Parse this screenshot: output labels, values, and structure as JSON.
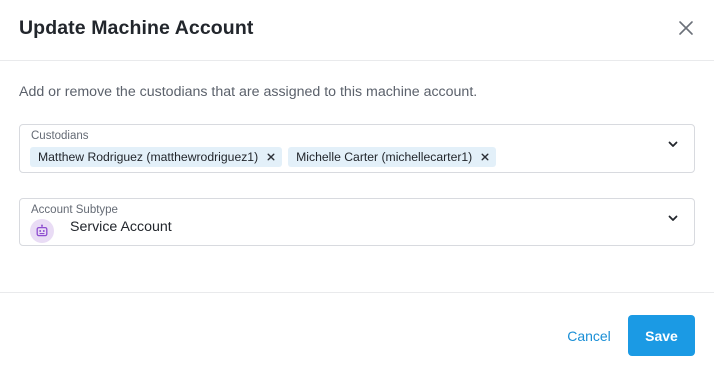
{
  "dialog": {
    "title": "Update Machine Account",
    "close_icon": "close-icon",
    "description": "Add or remove the custodians that are assigned to this machine account."
  },
  "custodians": {
    "label": "Custodians",
    "chevron_icon": "chevron-down-icon",
    "remove_icon": "close-icon",
    "selected": [
      "Matthew Rodriguez (matthewrodriguez1)",
      "Michelle Carter (michellecarter1)"
    ]
  },
  "account_subtype": {
    "label": "Account Subtype",
    "value": "Service Account",
    "value_icon": "robot-icon",
    "chevron_icon": "chevron-down-icon"
  },
  "footer": {
    "cancel_label": "Cancel",
    "save_label": "Save"
  },
  "colors": {
    "primary": "#1b9ae4",
    "chip_background": "#e3f0f9",
    "icon_badge_background": "#e9dcf5",
    "icon_color": "#8e4dd0",
    "border": "#d8dadf"
  }
}
